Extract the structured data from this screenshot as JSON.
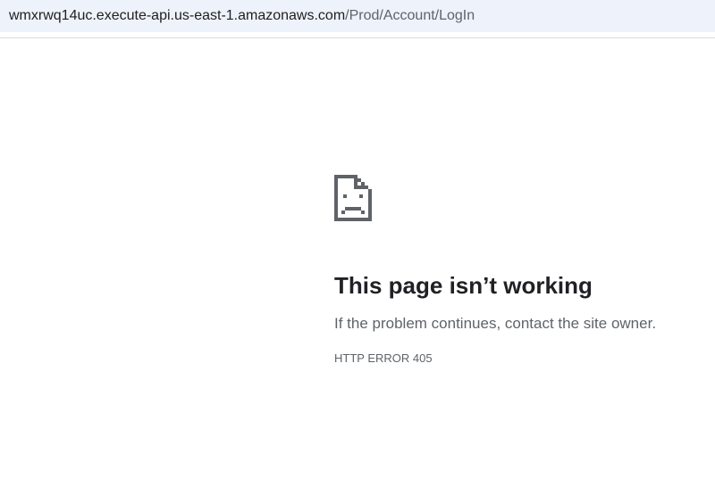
{
  "address_bar": {
    "url_host": "wmxrwq14uc.execute-api.us-east-1.amazonaws.com",
    "url_path": "/Prod/Account/LogIn"
  },
  "error": {
    "icon": "sad-page-icon",
    "title": "This page isn’t working",
    "message": "If the problem continues, contact the site owner.",
    "code": "HTTP ERROR 405"
  }
}
